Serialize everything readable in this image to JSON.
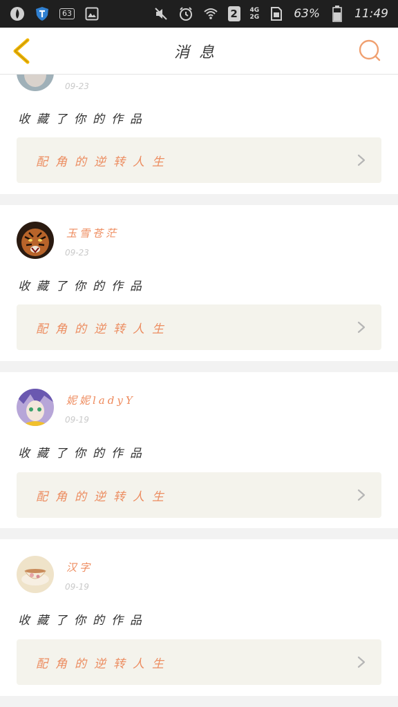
{
  "status_bar": {
    "notification_count": "63",
    "sim_slot": "2",
    "network_top": "4G",
    "network_bottom": "2G",
    "battery": "63%",
    "time": "11:49",
    "icons": [
      "app-drop-icon",
      "shield-t-icon",
      "notification-count-icon",
      "image-icon",
      "mute-icon",
      "alarm-icon",
      "wifi-icon",
      "sim2-icon",
      "signal-icon",
      "sim-card-icon",
      "battery-icon"
    ]
  },
  "header": {
    "title": "消息",
    "back_icon": "chevron-left-icon",
    "search_icon": "search-icon"
  },
  "colors": {
    "accent": "#ee8a5c",
    "back_arrow": "#f0b400",
    "card_bg": "#ffffff",
    "work_bg": "#f4f3ec"
  },
  "messages": [
    {
      "user": "",
      "time": "09-23",
      "action": "收藏了你的作品",
      "work_title": "配角的逆转人生",
      "avatar": "grey-portrait"
    },
    {
      "user": "玉雪苍茫",
      "time": "09-23",
      "action": "收藏了你的作品",
      "work_title": "配角的逆转人生",
      "avatar": "tiger"
    },
    {
      "user": "妮妮ladyY",
      "time": "09-19",
      "action": "收藏了你的作品",
      "work_title": "配角的逆转人生",
      "avatar": "anime-character"
    },
    {
      "user": "汉字",
      "time": "09-19",
      "action": "收藏了你的作品",
      "work_title": "配角的逆转人生",
      "avatar": "teacup"
    }
  ]
}
